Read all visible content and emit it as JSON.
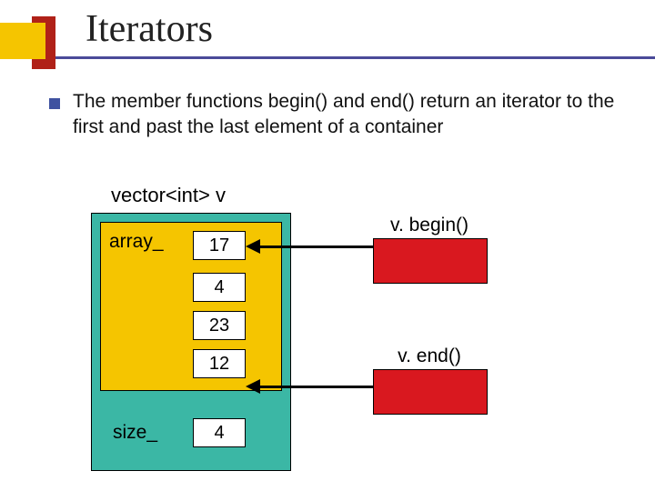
{
  "title": "Iterators",
  "body": "The member functions begin() and end() return an iterator to the first and past the last element of a container",
  "diagram": {
    "vector_label": "vector<int> v",
    "array_label": "array_",
    "size_label": "size_",
    "cells": {
      "c0": "17",
      "c1": "4",
      "c2": "23",
      "c3": "12"
    },
    "size_value": "4",
    "begin_label": "v. begin()",
    "end_label": "v. end()"
  }
}
